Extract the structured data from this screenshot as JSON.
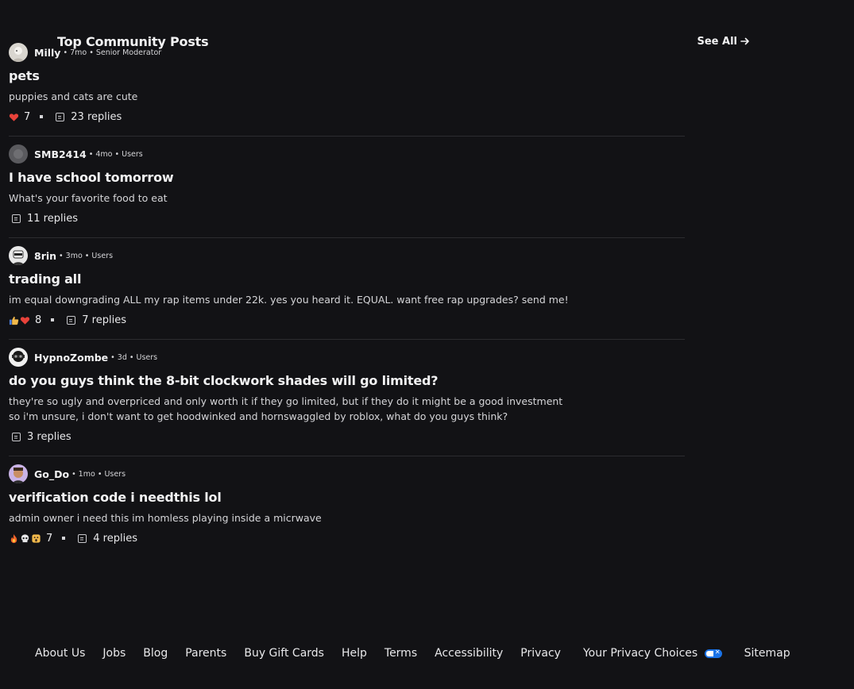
{
  "section": {
    "title": "Top Community Posts",
    "see_all": "See All"
  },
  "posts": [
    {
      "username": "Milly",
      "meta": "• 7mo • Senior Moderator",
      "title": "pets",
      "body": "puppies and cats are cute",
      "reactions": [
        "heart"
      ],
      "reaction_count": "7",
      "replies": "23 replies"
    },
    {
      "username": "SMB2414",
      "meta": "• 4mo • Users",
      "title": "I have school tomorrow",
      "body": "What's your favorite food to eat",
      "reactions": [],
      "reaction_count": "",
      "replies": "11 replies"
    },
    {
      "username": "8rin",
      "meta": "• 3mo • Users",
      "title": "trading all",
      "body": "im equal downgrading ALL my rap items under 22k. yes you heard it. EQUAL. want free rap upgrades? send me!",
      "reactions": [
        "thumbs-up",
        "heart"
      ],
      "reaction_count": "8",
      "replies": "7 replies"
    },
    {
      "username": "HypnoZombe",
      "meta": "• 3d • Users",
      "title": "do you guys think the 8-bit clockwork shades will go limited?",
      "body": "they're so ugly and overpriced and only worth it if they go limited, but if they do it might be a good investment",
      "body2": "so i'm unsure, i don't want to get hoodwinked and hornswaggled by roblox, what do you guys think?",
      "reactions": [],
      "reaction_count": "",
      "replies": "3 replies"
    },
    {
      "username": "Go_Do",
      "meta": "• 1mo • Users",
      "title": "verification code i needthis lol",
      "body": "admin owner i need this im homless playing inside a micrwave",
      "reactions": [
        "fire",
        "skull",
        "surprised"
      ],
      "reaction_count": "7",
      "replies": "4 replies"
    }
  ],
  "footer": {
    "links": [
      "About Us",
      "Jobs",
      "Blog",
      "Parents",
      "Buy Gift Cards",
      "Help",
      "Terms",
      "Accessibility",
      "Privacy",
      "Your Privacy Choices",
      "Sitemap"
    ]
  },
  "colors": {
    "background": "#121215",
    "text": "#f2f2f3",
    "divider": "#2c2c30",
    "privacy_badge": "#1a73e8"
  }
}
